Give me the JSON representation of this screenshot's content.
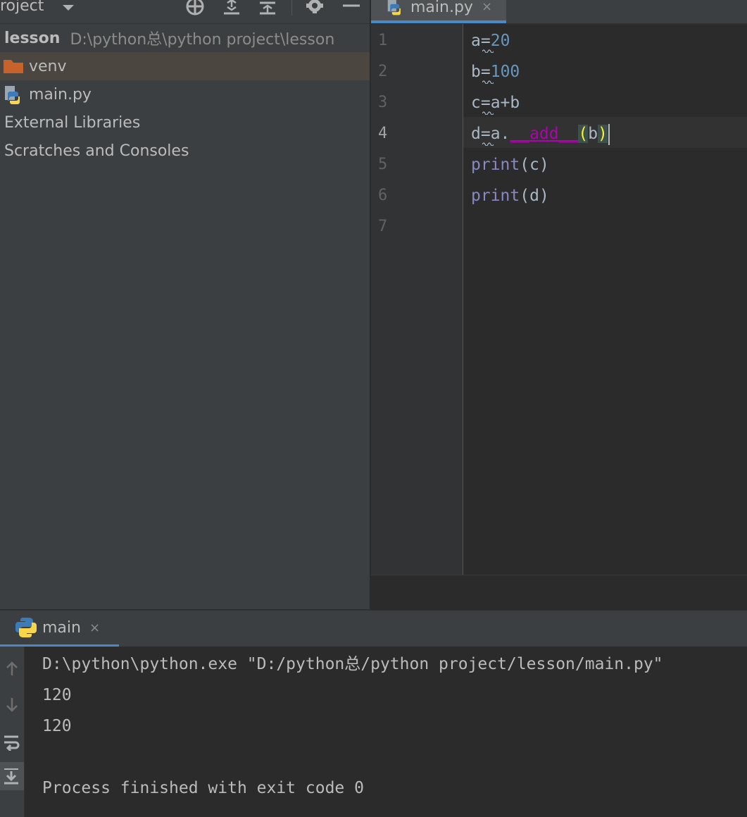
{
  "project_header": {
    "title": "roject",
    "icons": [
      "chevron-down-icon",
      "locate-icon",
      "expand-all-icon",
      "collapse-all-icon",
      "gear-icon",
      "minimize-icon"
    ]
  },
  "project_tree": {
    "root_name": "lesson",
    "root_path": "D:\\python总\\python project\\lesson",
    "items": [
      {
        "label": "venv",
        "icon": "folder-icon"
      },
      {
        "label": "main.py",
        "icon": "python-file-icon"
      },
      {
        "label": "External Libraries"
      },
      {
        "label": "Scratches and Consoles"
      }
    ]
  },
  "editor": {
    "tab_label": "main.py",
    "tab_close": "×",
    "line_numbers": [
      "1",
      "2",
      "3",
      "4",
      "5",
      "6",
      "7"
    ],
    "code": {
      "l1_var": "a",
      "l1_op": "=",
      "l1_val": "20",
      "l2_var": "b",
      "l2_op": "=",
      "l2_val": "100",
      "l3": "c=a+b",
      "l4_prefix": "d=a.",
      "l4_method": "__add__",
      "l4_open": "(",
      "l4_arg": "b",
      "l4_close": ")",
      "l5_fn": "print",
      "l5_args": "(c)",
      "l6_fn": "print",
      "l6_args": "(d)"
    }
  },
  "run": {
    "tab_label": "main",
    "tab_close": "×",
    "side_icons": [
      "up-arrow-icon",
      "down-arrow-icon",
      "soft-wrap-icon",
      "scroll-to-end-icon"
    ],
    "console_lines": [
      "D:\\python\\python.exe \"D:/python总/python project/lesson/main.py\"",
      "120",
      "120",
      "",
      "Process finished with exit code 0"
    ]
  },
  "colors": {
    "accent_tab_underline": "#4a88c7",
    "number": "#6897bb",
    "dunder_method": "#b200b2",
    "builtin": "#8888c6",
    "folder": "#c7622a"
  }
}
